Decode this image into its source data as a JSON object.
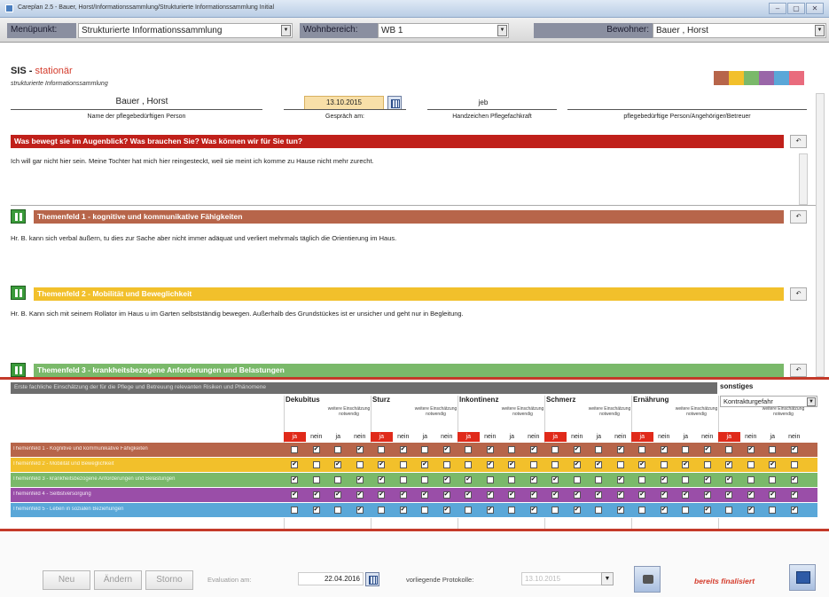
{
  "window": {
    "title": "Careplan 2.5 - Bauer, Horst/Informationssammlung/Strukturierte Informationssammlung Initial"
  },
  "menubar": {
    "menupunkt_label": "Menüpunkt:",
    "menupunkt_value": "Strukturierte Informationssammlung",
    "wohnbereich_label": "Wohnbereich:",
    "wohnbereich_value": "WB 1",
    "bewohner_label": "Bewohner:",
    "bewohner_value": "Bauer , Horst"
  },
  "header": {
    "title": "SIS",
    "title_suffix": "stationär",
    "subtitle": "strukturierte Informationssammlung",
    "swatch_colors": [
      "#b7654a",
      "#f2c02b",
      "#7ab96a",
      "#9a66a8",
      "#5aa7d8",
      "#e96b7d"
    ],
    "person_name": "Bauer , Horst",
    "person_caption": "Name der pflegebedürftigen Person",
    "gespraech_date": "13.10.2015",
    "gespraech_caption": "Gespräch am:",
    "handzeichen_value": "jeb",
    "handzeichen_caption": "Handzeichen Pflegefachkraft",
    "angehoerige_caption": "pflegebedürftige Person/Angehöriger/Betreuer"
  },
  "sections": [
    {
      "title": "Was bewegt sie im Augenblick? Was brauchen Sie? Was können wir für Sie tun?",
      "color": "#c0201a",
      "text": "Ich will gar nicht hier sein. Meine Tochter hat mich hier reingesteckt, weil sie meint ich komme zu Hause nicht mehr zurecht."
    },
    {
      "title": "Themenfeld 1 - kognitive und kommunikative Fähigkeiten",
      "color": "#b7654a",
      "text": "Hr. B. kann sich verbal äußern, tu dies zur Sache aber nicht immer adäquat und verliert mehrmals täglich die Orientierung im Haus."
    },
    {
      "title": "Themenfeld 2 - Mobilität und Beweglichkeit",
      "color": "#f2c02b",
      "text": "Hr. B. Kann sich mit seinem Rollator im Haus u im Garten selbstständig bewegen. Außerhalb des Grundstückes ist er unsicher und geht nur in Begleitung."
    },
    {
      "title": "Themenfeld 3 - krankheitsbezogene Anforderungen und Belastungen",
      "color": "#7ab96a",
      "text": ""
    }
  ],
  "matrix": {
    "title": "Erste fachliche Einschätzung der für die Pflege und Betreuung relevanten Risiken und Phänomene",
    "sonstiges_label": "sonstiges",
    "sonstiges_value": "Kontrakturgefahr",
    "note": "weitere Einschätzung notwendig",
    "ja": "ja",
    "nein": "nein",
    "groups": [
      "Dekubitus",
      "Sturz",
      "Inkontinenz",
      "Schmerz",
      "Ernährung"
    ],
    "rows": [
      {
        "label": "Themenfeld 1 - Kognitive und kommunikative Fähigkeiten",
        "color": "#b7654a",
        "checks": [
          0,
          1,
          0,
          1,
          0,
          1,
          0,
          1,
          0,
          1,
          0,
          1,
          0,
          1,
          0,
          1,
          0,
          1,
          0,
          1,
          0,
          1,
          0,
          1
        ]
      },
      {
        "label": "Themenfeld 2 - Mobilität und Beweglichkeit",
        "color": "#f2c02b",
        "checks": [
          1,
          0,
          1,
          0,
          1,
          0,
          1,
          0,
          0,
          1,
          1,
          0,
          0,
          1,
          1,
          0,
          1,
          0,
          1,
          0,
          1,
          0,
          1,
          0
        ]
      },
      {
        "label": "Themenfeld 3 - krankheitsbezogene Anforderungen und Belastungen",
        "color": "#7ab96a",
        "checks": [
          1,
          0,
          0,
          1,
          1,
          0,
          0,
          1,
          1,
          0,
          0,
          1,
          1,
          0,
          0,
          1,
          0,
          1,
          0,
          1,
          1,
          0,
          0,
          1
        ]
      },
      {
        "label": "Themenfeld 4 - Selbstversorgung",
        "color": "#9a4ea8",
        "checks": [
          1,
          1,
          1,
          1,
          1,
          1,
          1,
          1,
          1,
          1,
          1,
          1,
          1,
          1,
          1,
          1,
          1,
          1,
          1,
          1,
          1,
          1,
          1,
          1
        ]
      },
      {
        "label": "Themenfeld 5 - Leben in sozialen Beziehungen",
        "color": "#5aa7d8",
        "checks": [
          0,
          1,
          0,
          1,
          0,
          1,
          0,
          1,
          0,
          1,
          0,
          1,
          0,
          1,
          0,
          1,
          0,
          1,
          0,
          1,
          0,
          1,
          0,
          1
        ]
      }
    ]
  },
  "bottom": {
    "btn_neu": "Neu",
    "btn_aendern": "Ändern",
    "btn_storno": "Storno",
    "evaluation_label": "Evaluation am:",
    "evaluation_date": "22.04.2016",
    "protokolle_label": "vorliegende Protokolle:",
    "protokolle_value": "13.10.2015",
    "final_label": "bereits finalisiert"
  }
}
